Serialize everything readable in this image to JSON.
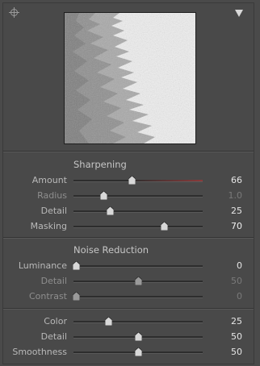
{
  "panel": {
    "collapse_glyph": "▼",
    "icons": [
      "target-adjust-icon",
      "collapse-triangle-icon"
    ],
    "accent_color": "#8a3a3a"
  },
  "sharpening": {
    "title": "Sharpening",
    "sliders": [
      {
        "label": "Amount",
        "value": "66",
        "position": 0.45,
        "state": "active"
      },
      {
        "label": "Radius",
        "value": "1.0",
        "position": 0.23,
        "state": "dim"
      },
      {
        "label": "Detail",
        "value": "25",
        "position": 0.28,
        "state": "active"
      },
      {
        "label": "Masking",
        "value": "70",
        "position": 0.7,
        "state": "bright"
      }
    ]
  },
  "noise_reduction": {
    "title": "Noise Reduction",
    "sliders": [
      {
        "label": "Luminance",
        "value": "0",
        "position": 0.02,
        "state": "active"
      },
      {
        "label": "Detail",
        "value": "50",
        "position": 0.5,
        "state": "dim"
      },
      {
        "label": "Contrast",
        "value": "0",
        "position": 0.02,
        "state": "dim"
      }
    ]
  },
  "color": {
    "sliders": [
      {
        "label": "Color",
        "value": "25",
        "position": 0.27,
        "state": "active"
      },
      {
        "label": "Detail",
        "value": "50",
        "position": 0.5,
        "state": "active"
      },
      {
        "label": "Smoothness",
        "value": "50",
        "position": 0.5,
        "state": "active"
      }
    ]
  }
}
